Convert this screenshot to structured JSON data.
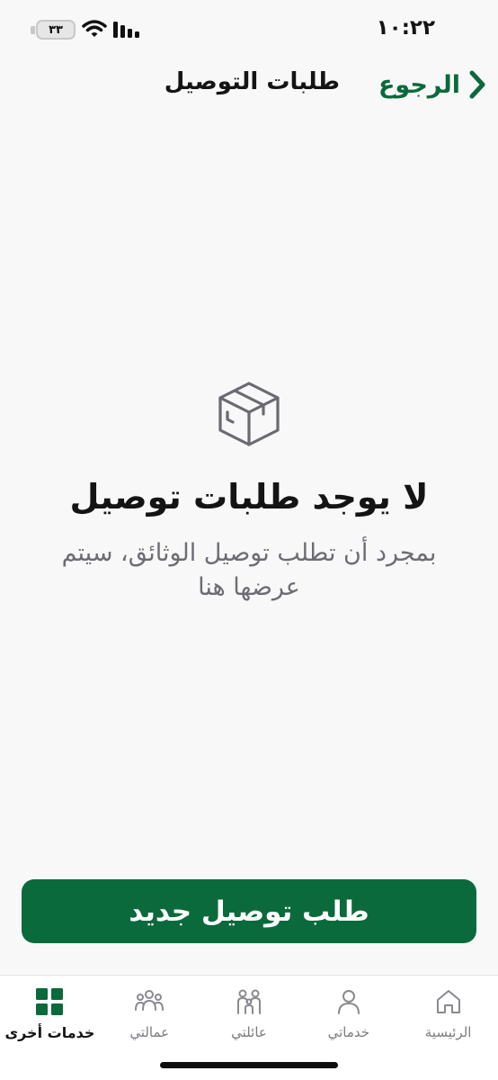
{
  "status_bar": {
    "time": "١٠:٢٢",
    "battery": "٣٣"
  },
  "header": {
    "back_label": "الرجوع",
    "title": "طلبات التوصيل"
  },
  "empty_state": {
    "icon": "box-icon",
    "title": "لا يوجد طلبات توصيل",
    "description": "بمجرد أن تطلب توصيل الوثائق، سيتم عرضها هنا"
  },
  "primary_action": {
    "label": "طلب توصيل جديد"
  },
  "tabs": [
    {
      "label": "الرئيسية",
      "icon": "home-icon",
      "active": false
    },
    {
      "label": "خدماتي",
      "icon": "person-icon",
      "active": false
    },
    {
      "label": "عائلتي",
      "icon": "family-icon",
      "active": false
    },
    {
      "label": "عمالتي",
      "icon": "workers-icon",
      "active": false
    },
    {
      "label": "خدمات أخرى",
      "icon": "grid-icon",
      "active": true
    }
  ],
  "colors": {
    "accent": "#0b6a3c",
    "background": "#f8f8f9",
    "muted_text": "#6c6c74",
    "inactive_icon": "#8a8a91"
  }
}
